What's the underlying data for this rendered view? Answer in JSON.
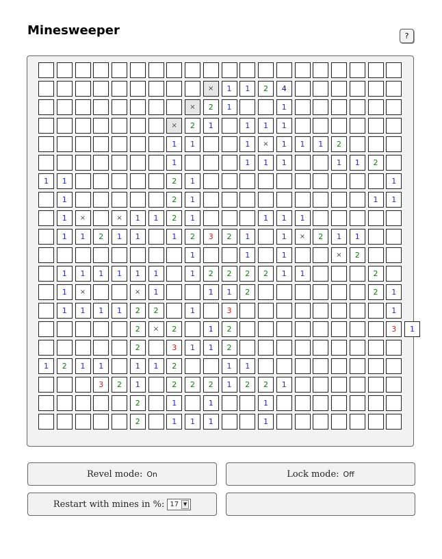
{
  "header": {
    "title": "Minesweeper",
    "help_label": "?"
  },
  "board": {
    "rows": [
      "                    ",
      "         X1124      ",
      "        X21  1      ",
      "       X21 111      ",
      "       11  1x1112   ",
      "       1   111  112 ",
      "11     21          1",
      " 1     21         11",
      " 1x x1121   111     ",
      " 11211 12321 1x211  ",
      "        1  1 1  x2  ",
      " 111111 1222211   2 ",
      " 1x  x1  112      21",
      " 111122 1 3        1",
      "     2x2 12        31",
      "     2 3112         ",
      "1211 112  11        ",
      "   321 2221221      ",
      "     2 1 1  1       ",
      "     2 111  1       "
    ],
    "legend": {
      " ": "unrevealed",
      "X": "flag (gray cross)",
      "x": "mine marker",
      "1-9": "adjacent mine count"
    }
  },
  "controls": {
    "revel_mode_label": "Revel mode:",
    "revel_mode_value": "On",
    "lock_mode_label": "Lock mode:",
    "lock_mode_value": "Off",
    "restart_label": "Restart with mines in %:",
    "restart_value": "17"
  }
}
